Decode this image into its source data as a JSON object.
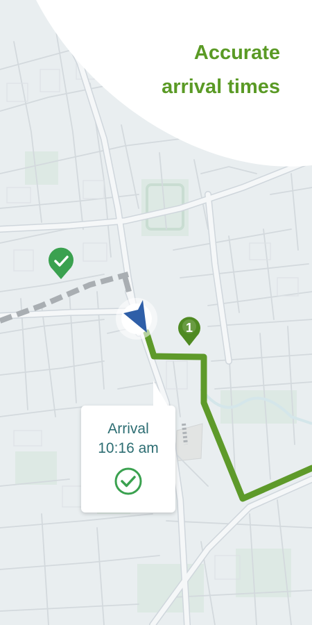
{
  "headline": {
    "line1": "Accurate",
    "line2": "arrival times"
  },
  "stop_marker": {
    "number": "1"
  },
  "arrival_callout": {
    "title": "Arrival",
    "time": "10:16 am"
  },
  "icons": {
    "navigation": "navigation-arrow-icon",
    "completed_stop": "check-pin-icon",
    "numbered_stop": "numbered-stop-pin",
    "arrival_status": "check-circle-icon"
  },
  "colors": {
    "brand_green": "#5a9a25",
    "route_green": "#5e9a2a",
    "stop_pin_green": "#4f8a22",
    "done_pin_green": "#3aa14f",
    "navigation_blue": "#2f5fa8",
    "callout_text": "#2c6d72",
    "map_background": "#e9eef0"
  }
}
